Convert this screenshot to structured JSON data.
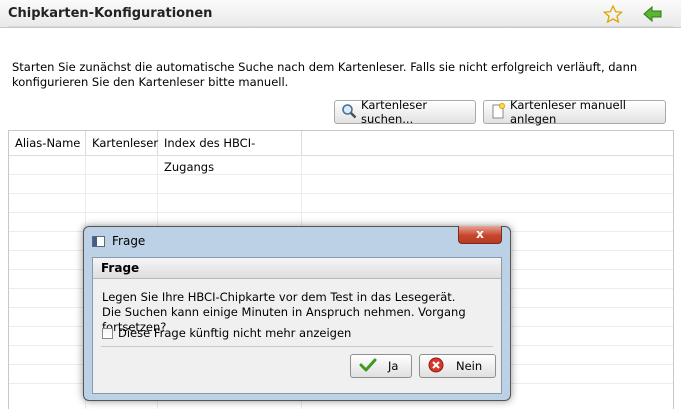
{
  "header": {
    "title": "Chipkarten-Konfigurationen",
    "icons": [
      "star-icon",
      "back-arrow-icon"
    ]
  },
  "intro": {
    "text": "Starten Sie zunächst die automatische Suche nach dem Kartenleser. Falls sie nicht erfolgreich verläuft, dann konfigurieren Sie den Kartenleser bitte manuell."
  },
  "toolbar": {
    "search_label": "Kartenleser suchen...",
    "manual_label": "Kartenleser manuell anlegen"
  },
  "table": {
    "columns": [
      "Alias-Name",
      "Kartenleser",
      "Index des HBCI-Zugangs"
    ],
    "rows": []
  },
  "dialog": {
    "window_title": "Frage",
    "close_glyph": "x",
    "heading": "Frage",
    "message_line1": "Legen Sie Ihre HBCI-Chipkarte vor dem Test in das Lesegerät.",
    "message_line2": "Die Suchen kann einige Minuten in Anspruch nehmen. Vorgang fortsetzen?",
    "checkbox_label": "Diese Frage künftig nicht mehr anzeigen",
    "checkbox_checked": false,
    "yes_label": "Ja",
    "no_label": "Nein"
  },
  "colors": {
    "accent_green": "#4a9e2a",
    "close_red": "#c6472e",
    "star_yellow": "#e6b800",
    "dialog_frame": "#bcd0e6"
  }
}
